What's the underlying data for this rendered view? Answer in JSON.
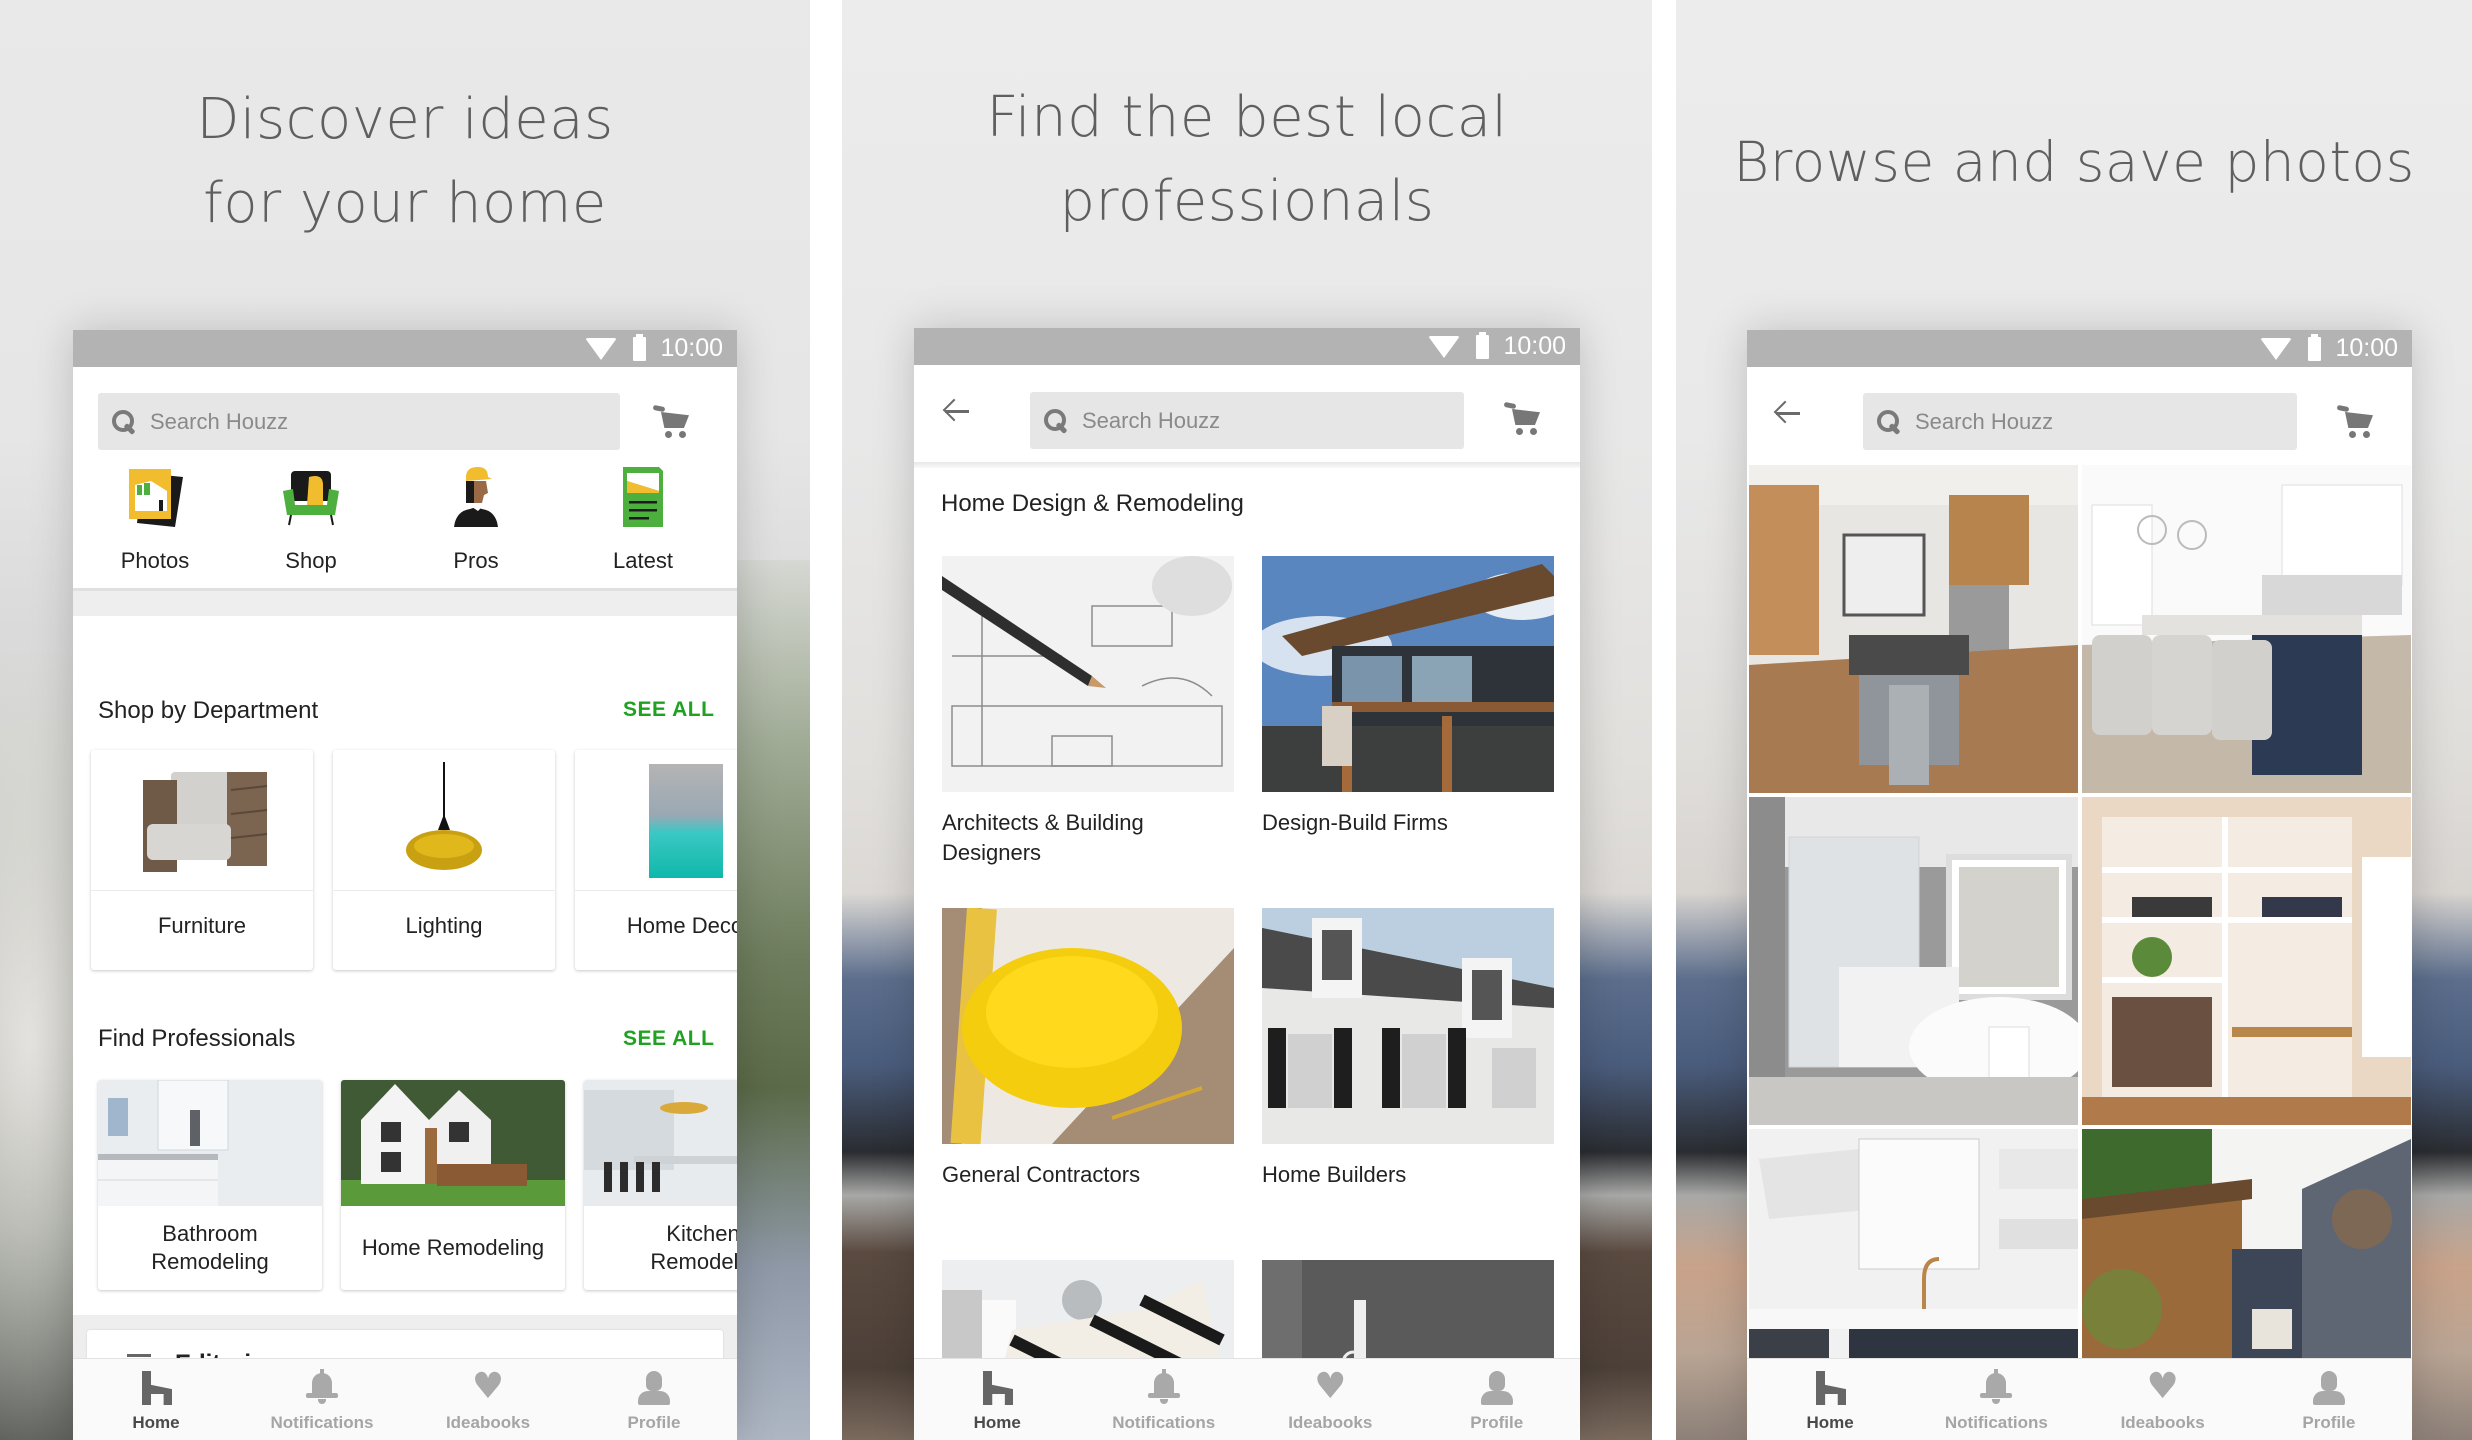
{
  "status_bar": {
    "time": "10:00"
  },
  "search": {
    "placeholder": "Search Houzz"
  },
  "bottom_nav": [
    {
      "label": "Home",
      "icon": "home-icon",
      "active": true
    },
    {
      "label": "Notifications",
      "icon": "bell-icon",
      "active": false
    },
    {
      "label": "Ideabooks",
      "icon": "heart-icon",
      "active": false
    },
    {
      "label": "Profile",
      "icon": "profile-icon",
      "active": false
    }
  ],
  "colors": {
    "accent_green": "#21a121",
    "status_bar": "#b3b3b3",
    "headline_text": "#5f5f5f",
    "brand_yellow": "#f2bc2f",
    "brand_green": "#4caf3e"
  },
  "panel1": {
    "headline_line1": "Discover ideas",
    "headline_line2": "for your home",
    "shortcuts": [
      {
        "label": "Photos",
        "icon": "photos-icon"
      },
      {
        "label": "Shop",
        "icon": "shop-icon"
      },
      {
        "label": "Pros",
        "icon": "pros-icon"
      },
      {
        "label": "Latest",
        "icon": "latest-icon"
      }
    ],
    "shop_section": {
      "title": "Shop by Department",
      "see_all": "SEE ALL",
      "items": [
        {
          "label": "Furniture",
          "image": "armchair"
        },
        {
          "label": "Lighting",
          "image": "pendant-lamp"
        },
        {
          "label": "Home Deco",
          "image": "turquoise-rug"
        }
      ]
    },
    "pros_section": {
      "title": "Find Professionals",
      "see_all": "SEE ALL",
      "items": [
        {
          "line1": "Bathroom",
          "line2": "Remodeling",
          "image": "white-bathroom"
        },
        {
          "line1": "Home Remodeling",
          "line2": "",
          "image": "white-house"
        },
        {
          "line1": "Kitchen",
          "line2": "Remodelin",
          "image": "kitchen-island"
        }
      ]
    },
    "editorial_partial": "Editori"
  },
  "panel2": {
    "headline_line1": "Find the best local",
    "headline_line2": "professionals",
    "section_title": "Home Design & Remodeling",
    "tiles": [
      {
        "line1": "Architects & Building",
        "line2": "Designers",
        "image": "blueprint-pencil"
      },
      {
        "line1": "Design-Build Firms",
        "line2": "",
        "image": "modern-house"
      },
      {
        "line1": "General Contractors",
        "line2": "",
        "image": "hard-hat"
      },
      {
        "line1": "Home Builders",
        "line2": "",
        "image": "colonial-house"
      },
      {
        "line1": "",
        "line2": "",
        "image": "striped-sofa"
      },
      {
        "line1": "",
        "line2": "",
        "image": "gray-bathroom"
      }
    ]
  },
  "panel3": {
    "headline": "Browse and save photos",
    "photos": [
      {
        "alt": "wood kitchen"
      },
      {
        "alt": "white kitchen with navy island"
      },
      {
        "alt": "gray bathroom with tub"
      },
      {
        "alt": "home office shelves"
      },
      {
        "alt": "white kitchen with brass faucet"
      },
      {
        "alt": "backyard shed"
      }
    ]
  }
}
